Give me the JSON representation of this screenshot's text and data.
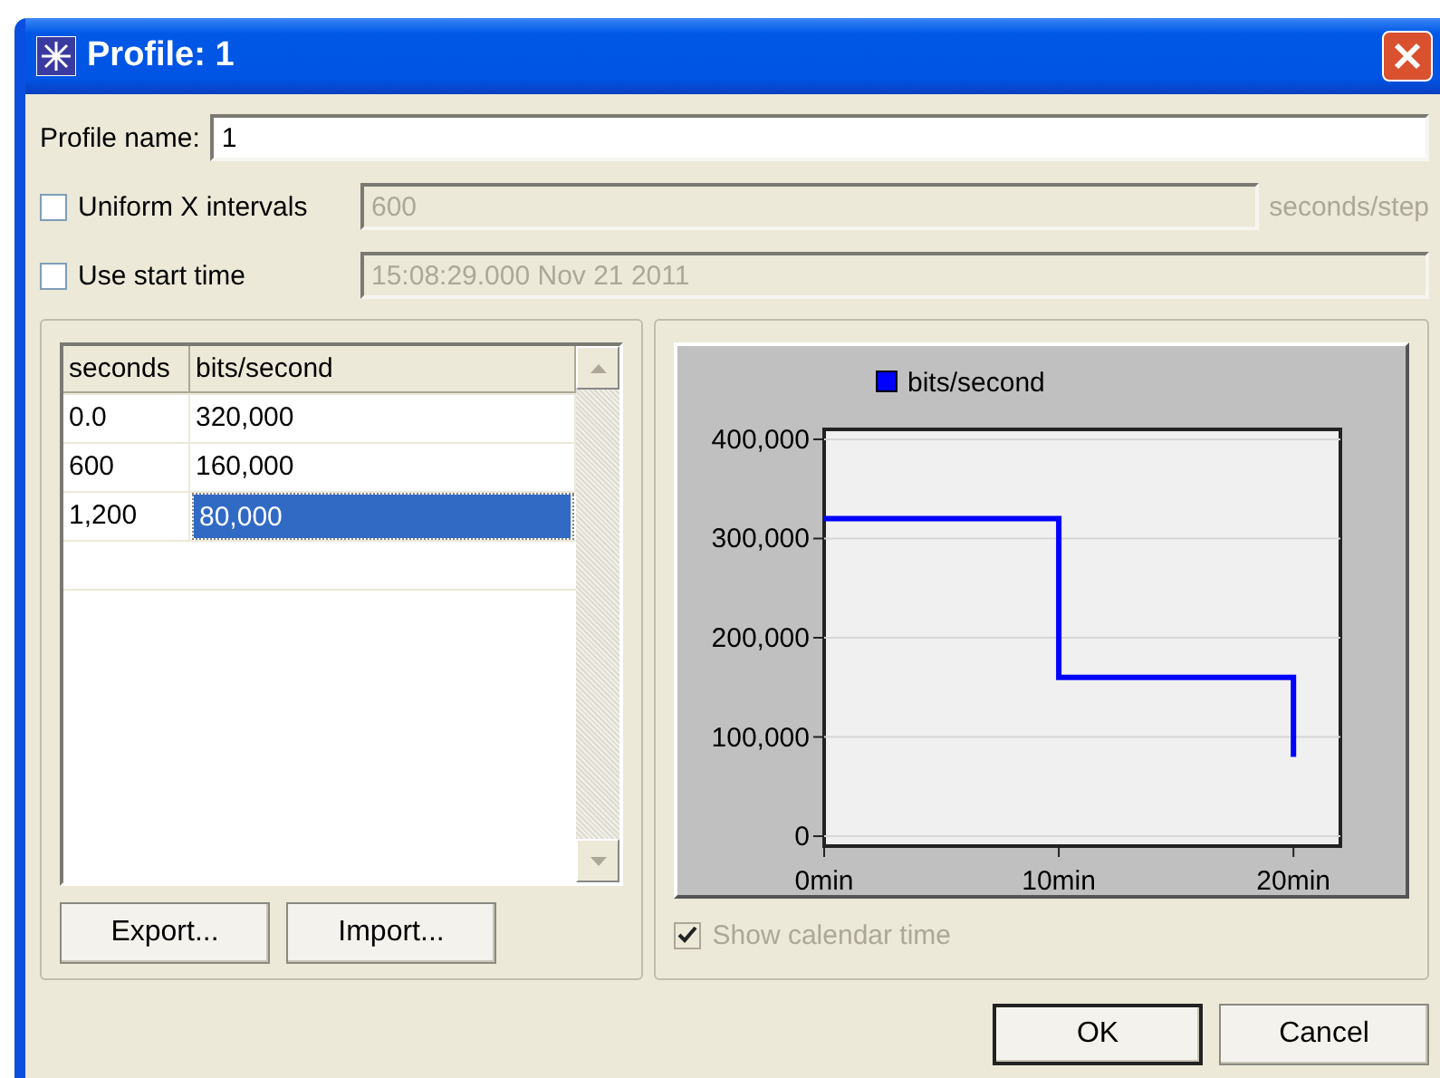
{
  "window": {
    "title": "Profile: 1"
  },
  "profile_name": {
    "label": "Profile name:",
    "value": "1"
  },
  "uniform_x": {
    "label": "Uniform X intervals",
    "checked": false,
    "value": "600",
    "unit": "seconds/step",
    "disabled": true
  },
  "start_time": {
    "label": "Use start time",
    "checked": false,
    "value": "15:08:29.000 Nov 21 2011",
    "disabled": true
  },
  "table": {
    "columns": [
      "seconds",
      "bits/second"
    ],
    "rows": [
      {
        "cells": [
          "0.0",
          "320,000"
        ],
        "selected": false
      },
      {
        "cells": [
          "600",
          "160,000"
        ],
        "selected": false
      },
      {
        "cells": [
          "1,200",
          "80,000"
        ],
        "selected": true
      }
    ]
  },
  "table_buttons": [
    "Export...",
    "Import..."
  ],
  "chart": {
    "chart_data": {
      "type": "line",
      "grid": true,
      "x": [
        0,
        10,
        10,
        20,
        20
      ],
      "series": [
        {
          "name": "bits/second",
          "color": "#0000ff",
          "values": [
            320000,
            320000,
            160000,
            160000,
            80000
          ]
        }
      ],
      "xlim": [
        0,
        22
      ],
      "ylim": [
        -10000,
        410000
      ],
      "xticks": [
        {
          "value": 0,
          "label": "0min"
        },
        {
          "value": 10,
          "label": "10min"
        },
        {
          "value": 20,
          "label": "20min"
        }
      ],
      "yticks": [
        {
          "value": 0,
          "label": "0"
        },
        {
          "value": 100000,
          "label": "100,000"
        },
        {
          "value": 200000,
          "label": "200,000"
        },
        {
          "value": 300000,
          "label": "300,000"
        },
        {
          "value": 400000,
          "label": "400,000"
        }
      ]
    }
  },
  "show_calendar": {
    "label": "Show calendar time",
    "checked": true,
    "disabled": true
  },
  "buttons": [
    {
      "label": "OK",
      "default": true
    },
    {
      "label": "Cancel",
      "default": false
    }
  ]
}
